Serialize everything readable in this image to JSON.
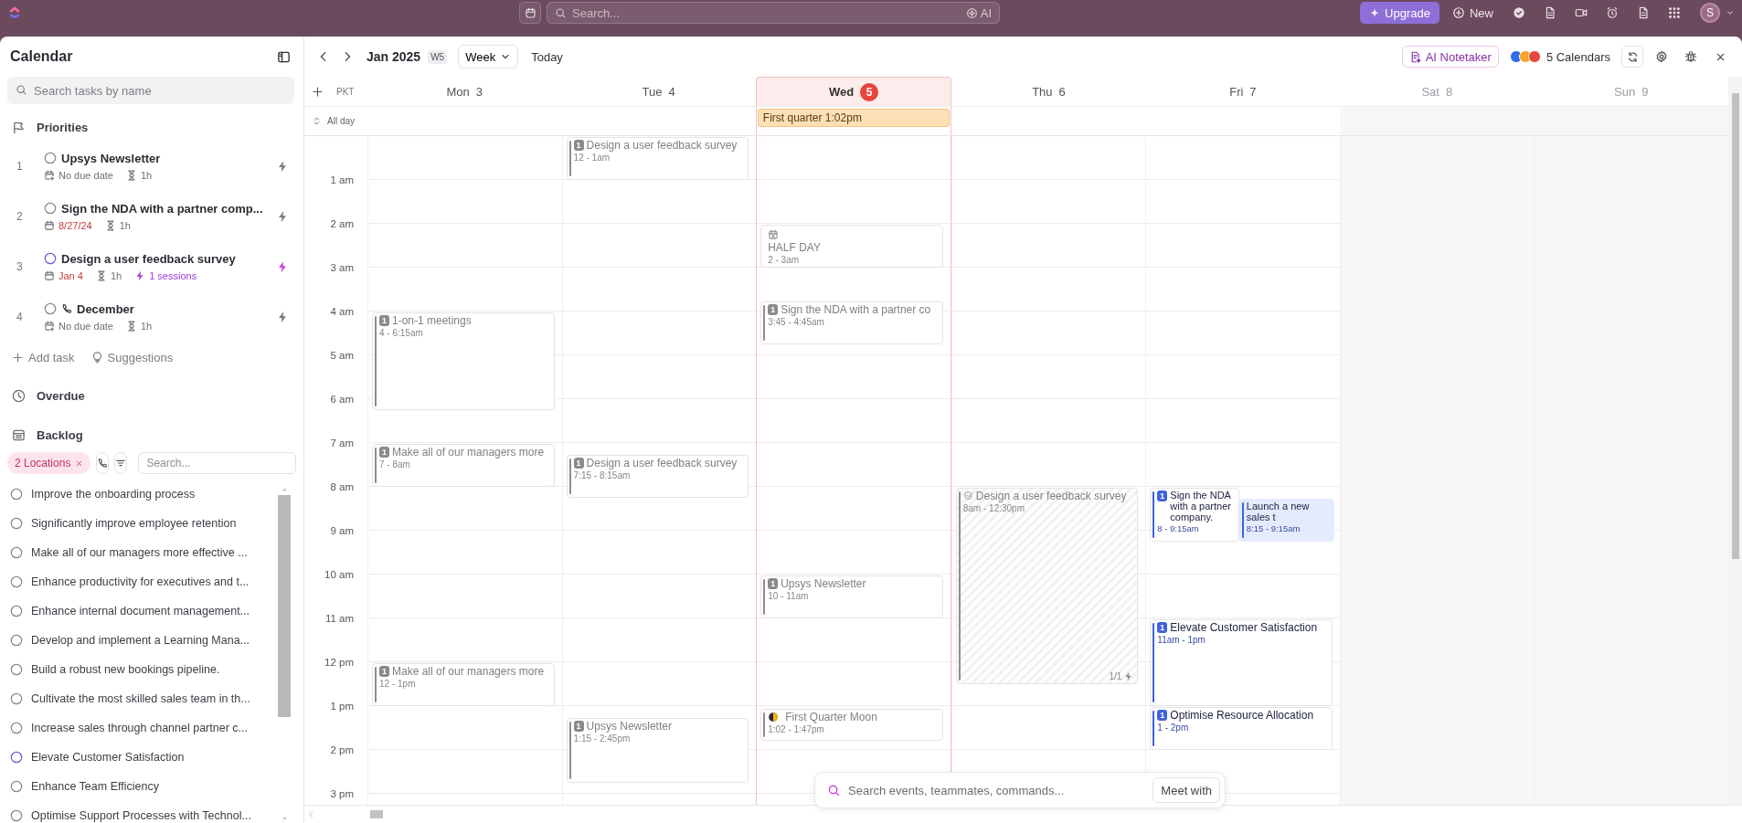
{
  "topbar": {
    "search_placeholder": "Search...",
    "ai_label": "AI",
    "upgrade": "Upgrade",
    "new": "New",
    "avatar": "S"
  },
  "sidebar": {
    "title": "Calendar",
    "search_placeholder": "Search tasks by name",
    "priorities_label": "Priorities",
    "priorities": [
      {
        "number": "1",
        "title": "Upsys Newsletter",
        "due": "No due date",
        "overdue": false,
        "duration": "1h",
        "active": false,
        "phone": false
      },
      {
        "number": "2",
        "title": "Sign the NDA with a partner comp...",
        "due": "8/27/24",
        "overdue": true,
        "duration": "1h",
        "active": false,
        "phone": false
      },
      {
        "number": "3",
        "title": "Design a user feedback survey",
        "due": "Jan 4",
        "overdue": true,
        "duration": "1h",
        "sessions": "1 sessions",
        "active": true,
        "phone": false
      },
      {
        "number": "4",
        "title": "December",
        "due": "No due date",
        "overdue": false,
        "duration": "1h",
        "active": false,
        "phone": true
      }
    ],
    "add_task": "Add task",
    "suggestions": "Suggestions",
    "overdue_label": "Overdue",
    "backlog_label": "Backlog",
    "filter_chip": "2 Locations",
    "backlog_search_placeholder": "Search...",
    "backlog": [
      {
        "title": "Improve the onboarding process",
        "active": false
      },
      {
        "title": "Significantly improve employee retention",
        "active": false
      },
      {
        "title": "Make all of our managers more effective ...",
        "active": false
      },
      {
        "title": "Enhance productivity for executives and t...",
        "active": false
      },
      {
        "title": "Enhance internal document management...",
        "active": false
      },
      {
        "title": "Develop and implement a Learning Mana...",
        "active": false
      },
      {
        "title": "Build a robust new bookings pipeline.",
        "active": false
      },
      {
        "title": "Cultivate the most skilled sales team in th...",
        "active": false
      },
      {
        "title": "Increase sales through channel partner c...",
        "active": false
      },
      {
        "title": "Elevate Customer Satisfaction",
        "active": true
      },
      {
        "title": "Enhance Team Efficiency",
        "active": false
      },
      {
        "title": "Optimise Support Processes with Technol...",
        "active": false
      }
    ]
  },
  "toolbar": {
    "month": "Jan 2025",
    "week": "W5",
    "view": "Week",
    "today": "Today",
    "notetaker": "AI Notetaker",
    "calendars": {
      "label": "5 Calendars",
      "dots": [
        {
          "color": "#2f6bed"
        },
        {
          "color": "#f5a524"
        },
        {
          "color": "#e8453c"
        }
      ]
    }
  },
  "timezone": "PKT",
  "all_day_label": "All day",
  "hours": [
    "1 am",
    "2 am",
    "3 am",
    "4 am",
    "5 am",
    "6 am",
    "7 am",
    "8 am",
    "9 am",
    "10 am",
    "11 am",
    "12 pm",
    "1 pm",
    "2 pm",
    "3 pm"
  ],
  "days": [
    {
      "name": "Mon",
      "date": "3",
      "today": false,
      "weekend": false,
      "events": [
        {
          "kind": "task",
          "badge": "1",
          "title": "1-on-1 meetings",
          "time": "4 - 6:15am",
          "past": true
        },
        {
          "kind": "task",
          "badge": "1",
          "title": "Make all of our managers more",
          "time": "7 - 8am",
          "past": true
        },
        {
          "kind": "task",
          "badge": "1",
          "title": "Make all of our managers more",
          "time": "12 - 1pm",
          "past": true
        }
      ]
    },
    {
      "name": "Tue",
      "date": "4",
      "today": false,
      "weekend": false,
      "events": [
        {
          "kind": "task",
          "badge": "1",
          "title": "Design a user feedback survey",
          "time": "12 - 1am",
          "past": true
        },
        {
          "kind": "task",
          "badge": "1",
          "title": "Design a user feedback survey",
          "time": "7:15 - 8:15am",
          "past": true
        },
        {
          "kind": "task",
          "badge": "1",
          "title": "Upsys Newsletter",
          "time": "1:15 - 2:45pm",
          "past": true
        }
      ]
    },
    {
      "name": "Wed",
      "date": "5",
      "today": true,
      "weekend": false,
      "all_day": [
        {
          "title": "First quarter 1:02pm"
        }
      ],
      "events": [
        {
          "kind": "leave",
          "title": "HALF DAY",
          "time": "2 - 3am",
          "past": true
        },
        {
          "kind": "task",
          "badge": "1",
          "title": "Sign the NDA with a partner co",
          "time": "3:45 - 4:45am",
          "past": true
        },
        {
          "kind": "task",
          "badge": "1",
          "title": "Upsys Newsletter",
          "time": "10 - 11am",
          "past": true
        },
        {
          "kind": "moon",
          "title": "First Quarter Moon",
          "time": "1:02 - 1:47pm",
          "past": true
        }
      ]
    },
    {
      "name": "Thu",
      "date": "6",
      "today": false,
      "weekend": false,
      "events": [
        {
          "kind": "block",
          "title": "Design a user feedback survey",
          "time": "8am - 12:30pm",
          "progress": "1/1",
          "past": true
        }
      ]
    },
    {
      "name": "Fri",
      "date": "7",
      "today": false,
      "weekend": false,
      "events": [
        {
          "kind": "task",
          "badge": "1",
          "title": "Sign the NDA with a partner company.",
          "time": "8 - 9:15am",
          "past": false
        },
        {
          "kind": "event",
          "title": "Launch a new sales t",
          "time": "8:15 - 9:15am",
          "past": false
        },
        {
          "kind": "task",
          "badge": "1",
          "title": "Elevate Customer Satisfaction",
          "time": "11am - 1pm",
          "past": false
        },
        {
          "kind": "task",
          "badge": "1",
          "title": "Optimise Resource Allocation",
          "time": "1 - 2pm",
          "past": false
        }
      ]
    },
    {
      "name": "Sat",
      "date": "8",
      "today": false,
      "weekend": true
    },
    {
      "name": "Sun",
      "date": "9",
      "today": false,
      "weekend": true
    }
  ],
  "command_bar": {
    "placeholder": "Search events, teammates, commands...",
    "button": "Meet with"
  }
}
